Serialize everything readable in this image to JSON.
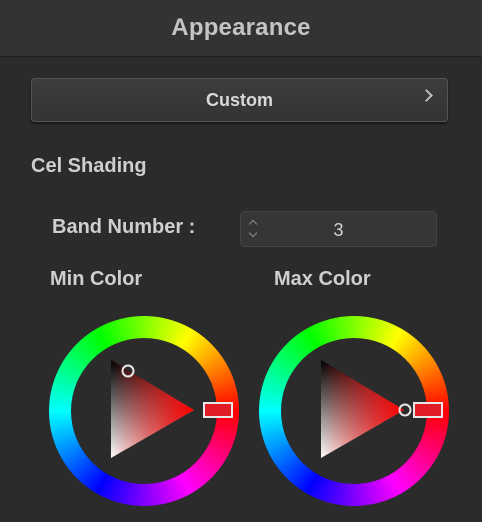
{
  "header": {
    "title": "Appearance"
  },
  "preset": {
    "label": "Custom"
  },
  "cel_shading": {
    "title": "Cel Shading",
    "band_label": "Band Number :",
    "band_value": "3"
  },
  "min_color": {
    "label": "Min Color",
    "hue": "#ff0000"
  },
  "max_color": {
    "label": "Max Color",
    "hue": "#ff0000"
  },
  "colors": {
    "background": "#2b2b2b",
    "header": "#333333",
    "text": "#cfcfcf"
  }
}
